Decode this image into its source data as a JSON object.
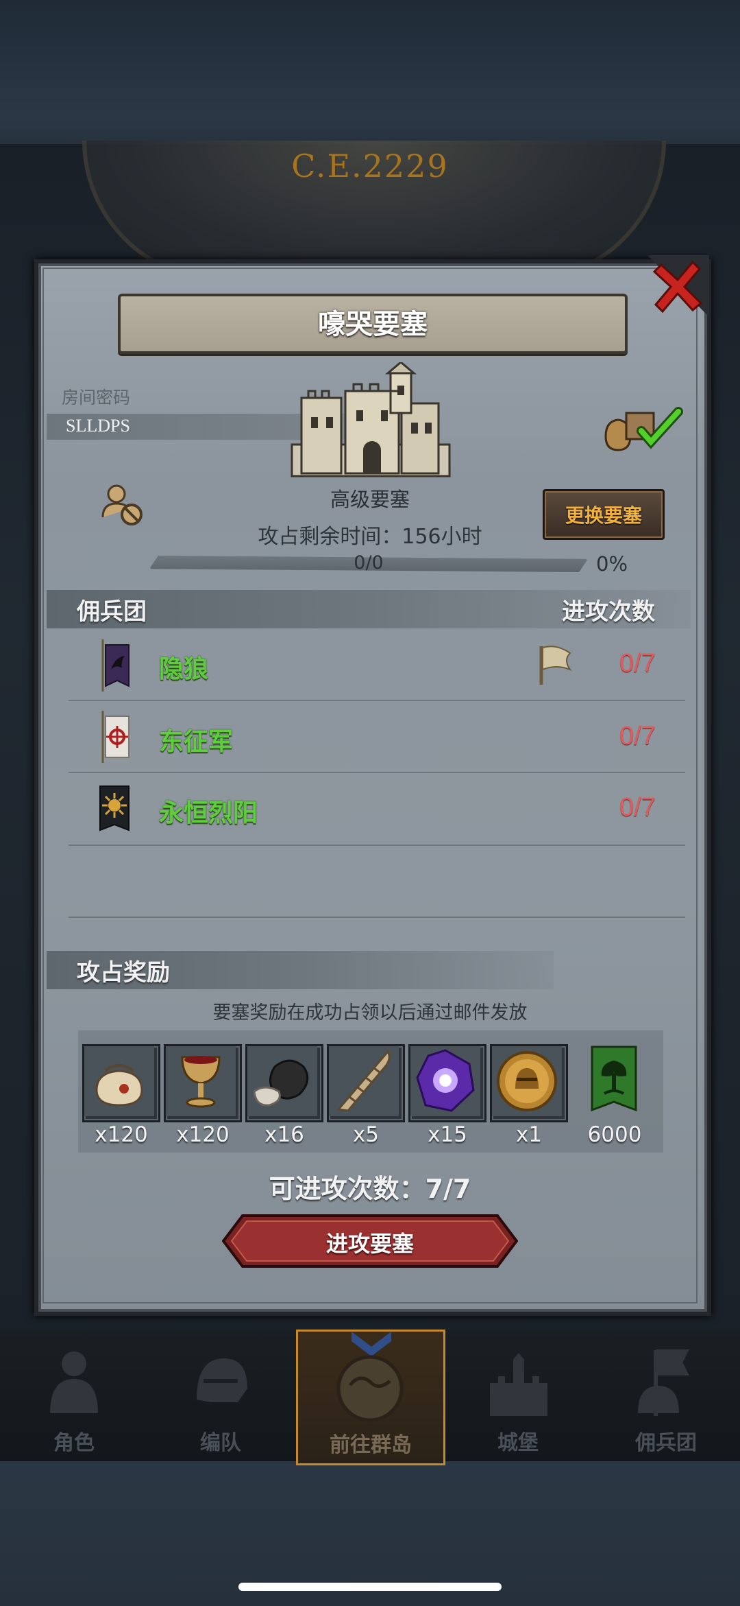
{
  "background": {
    "clock_year": "C.E.2229"
  },
  "dialog": {
    "title": "嚎哭要塞",
    "room_label": "房间密码",
    "room_code": "SLLDPS",
    "fortress_name": "高级要塞",
    "time_remaining": "攻占剩余时间：156小时",
    "change_button": "更换要塞",
    "progress_text": "0/0",
    "progress_pct": "0%",
    "progress_value": 0
  },
  "mercenaries": {
    "header": "佣兵团",
    "attack_header": "进攻次数",
    "rows": [
      {
        "name": "隐狼",
        "count": "0/7",
        "banner_icon": "wolf-banner-icon",
        "flag": true
      },
      {
        "name": "东征军",
        "count": "0/7",
        "banner_icon": "cross-banner-icon",
        "flag": false
      },
      {
        "name": "永恒烈阳",
        "count": "0/7",
        "banner_icon": "sun-banner-icon",
        "flag": false
      }
    ]
  },
  "rewards": {
    "header": "攻占奖励",
    "note": "要塞奖励在成功占领以后通过邮件发放",
    "items": [
      {
        "icon": "pouch-icon",
        "count": "x120"
      },
      {
        "icon": "goblet-icon",
        "count": "x120"
      },
      {
        "icon": "ore-icon",
        "count": "x16"
      },
      {
        "icon": "horn-icon",
        "count": "x5"
      },
      {
        "icon": "purple-gem-icon",
        "count": "x15"
      },
      {
        "icon": "knight-coin-icon",
        "count": "x1"
      },
      {
        "icon": "tree-banner-icon",
        "count": "6000"
      }
    ]
  },
  "attack": {
    "attempts": "可进攻次数：7/7",
    "button": "进攻要塞"
  },
  "nav": {
    "items": [
      {
        "label": "角色",
        "icon": "knight-icon"
      },
      {
        "label": "编队",
        "icon": "helmet-icon"
      },
      {
        "label": "前往群岛",
        "icon": "map-icon"
      },
      {
        "label": "城堡",
        "icon": "castle-icon"
      },
      {
        "label": "佣兵团",
        "icon": "mercenary-icon"
      }
    ],
    "active_index": 2
  },
  "colors": {
    "accent_gold": "#f2b13c",
    "merc_green": "#5fce3c",
    "count_red": "#e05c5c",
    "button_red": "#7a2222"
  }
}
